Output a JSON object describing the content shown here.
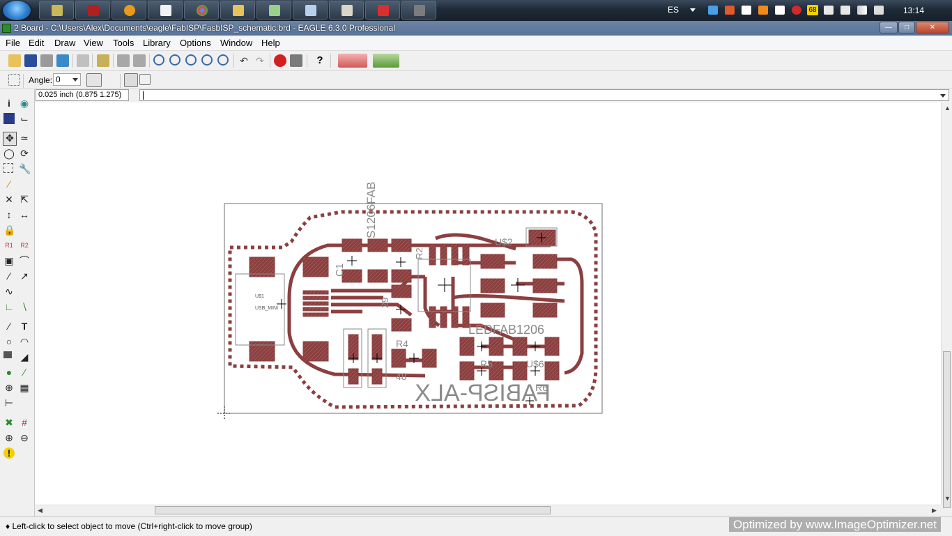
{
  "taskbar": {
    "language": "ES",
    "clock": "13:14",
    "badge_count": "68"
  },
  "window": {
    "title": "2 Board - C:\\Users\\Alex\\Documents\\eagle\\FabISP\\FasbISP_schematic.brd - EAGLE 6.3.0 Professional"
  },
  "menu": [
    "File",
    "Edit",
    "Draw",
    "View",
    "Tools",
    "Library",
    "Options",
    "Window",
    "Help"
  ],
  "toolbar2": {
    "angle_label": "Angle:",
    "angle_value": "0"
  },
  "cmdrow": {
    "coordinates": "0.025 inch (0.875 1.275)"
  },
  "board": {
    "labels": {
      "top_vertical": "S1206FAB",
      "cap": "C1",
      "r2": "R2",
      "r4": "R4",
      "r5": "R5",
      "r6": "R6",
      "us1": "U$1",
      "usb": "USB_MINI",
      "num29": "29",
      "num48": "48",
      "mirror_text": "FABISP-ALX",
      "u2": "U$2",
      "u6": "U$6",
      "part_ref": "LEDFAB1206"
    },
    "colors": {
      "copper": "#8b3f3f",
      "pad_fill": "#8b3f3f",
      "outline": "#7d7d7d",
      "silk": "#8a8a8a"
    }
  },
  "status": {
    "hint": "Left-click to select object to move (Ctrl+right-click to move group)",
    "watermark": "Optimized by www.ImageOptimizer.net"
  }
}
